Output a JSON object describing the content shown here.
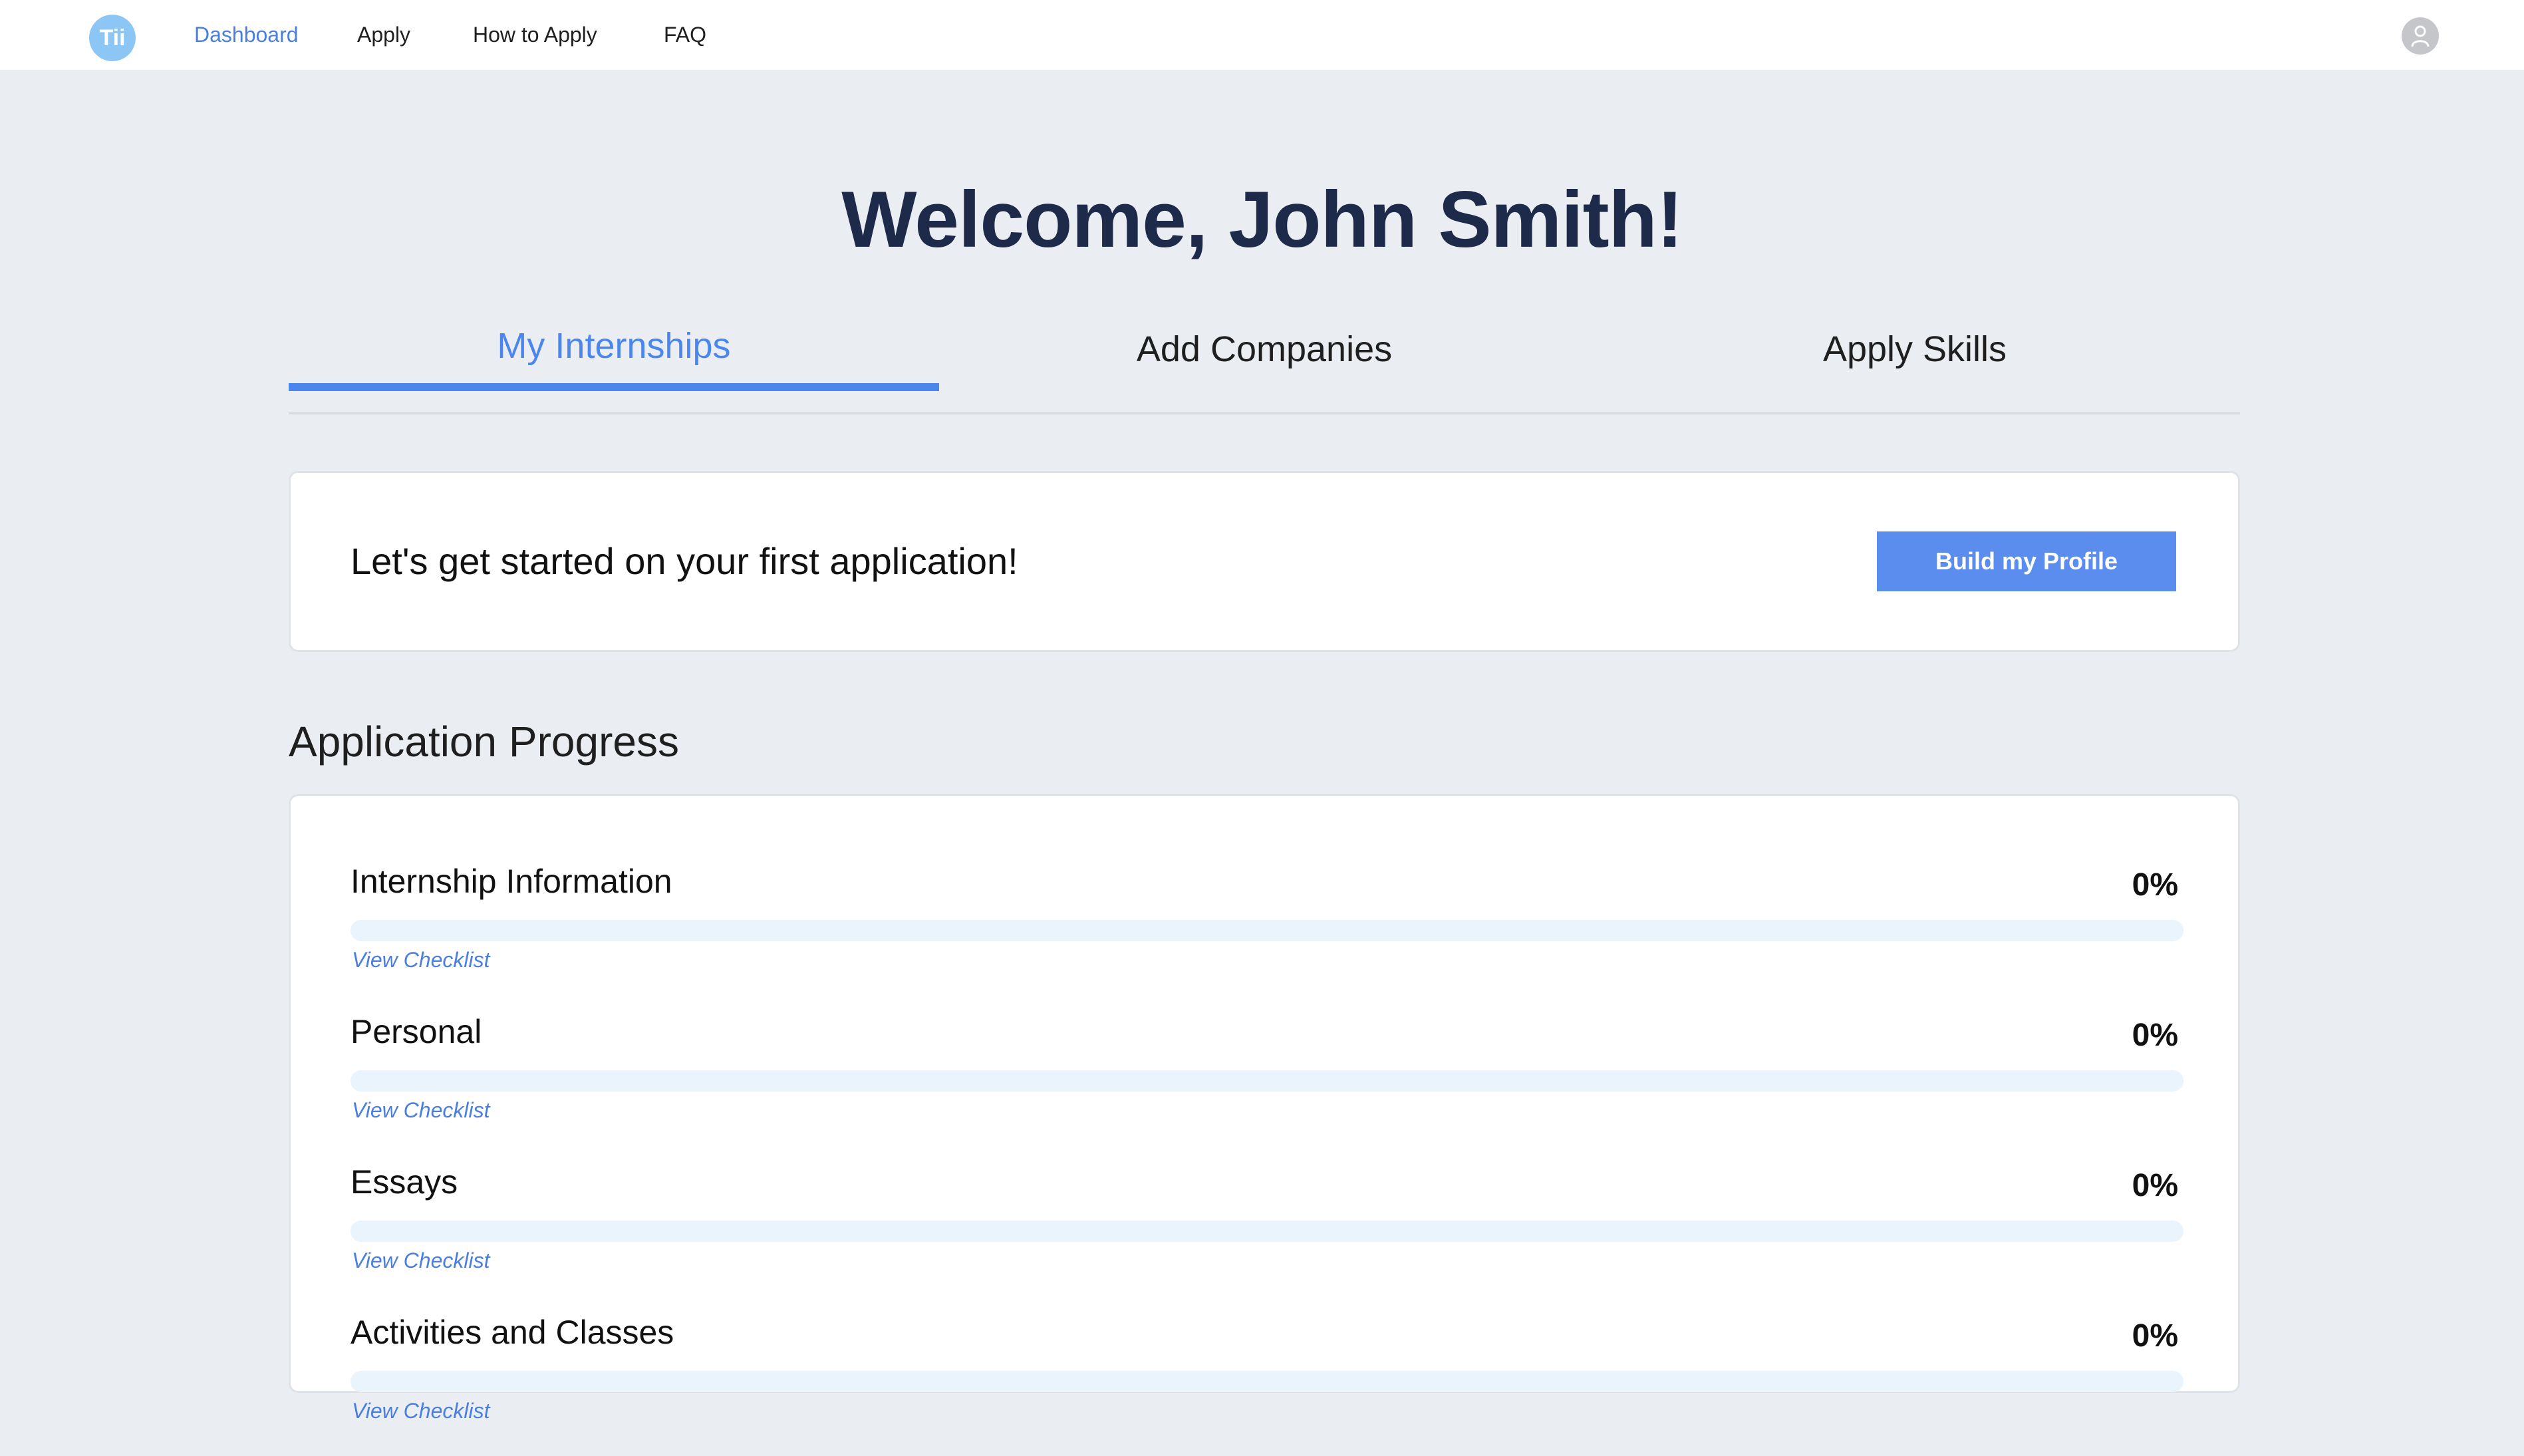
{
  "nav": {
    "logo_text": "Tii",
    "links": [
      "Dashboard",
      "Apply",
      "How to Apply",
      "FAQ"
    ],
    "active": "Dashboard",
    "avatar_icon": "user-avatar-icon"
  },
  "header": {
    "welcome": "Welcome, John Smith!"
  },
  "tabs": [
    {
      "label": "My Internships",
      "active": true
    },
    {
      "label": "Add Companies",
      "active": false
    },
    {
      "label": "Apply Skills",
      "active": false
    }
  ],
  "start_card": {
    "text": "Let's get started on your first application!",
    "button_label": "Build my Profile"
  },
  "progress": {
    "title": "Application Progress",
    "link_label": "View Checklist",
    "items": [
      {
        "label": "Internship Information",
        "percent_text": "0%",
        "value": 0
      },
      {
        "label": "Personal",
        "percent_text": "0%",
        "value": 0
      },
      {
        "label": "Essays",
        "percent_text": "0%",
        "value": 0
      },
      {
        "label": "Activities and Classes",
        "percent_text": "0%",
        "value": 0
      }
    ]
  },
  "colors": {
    "accent": "#4a86ec",
    "button": "#5b8def",
    "heading": "#1e2a4a",
    "page_bg": "#eaeef2",
    "progress_track": "#e9f4fd"
  }
}
